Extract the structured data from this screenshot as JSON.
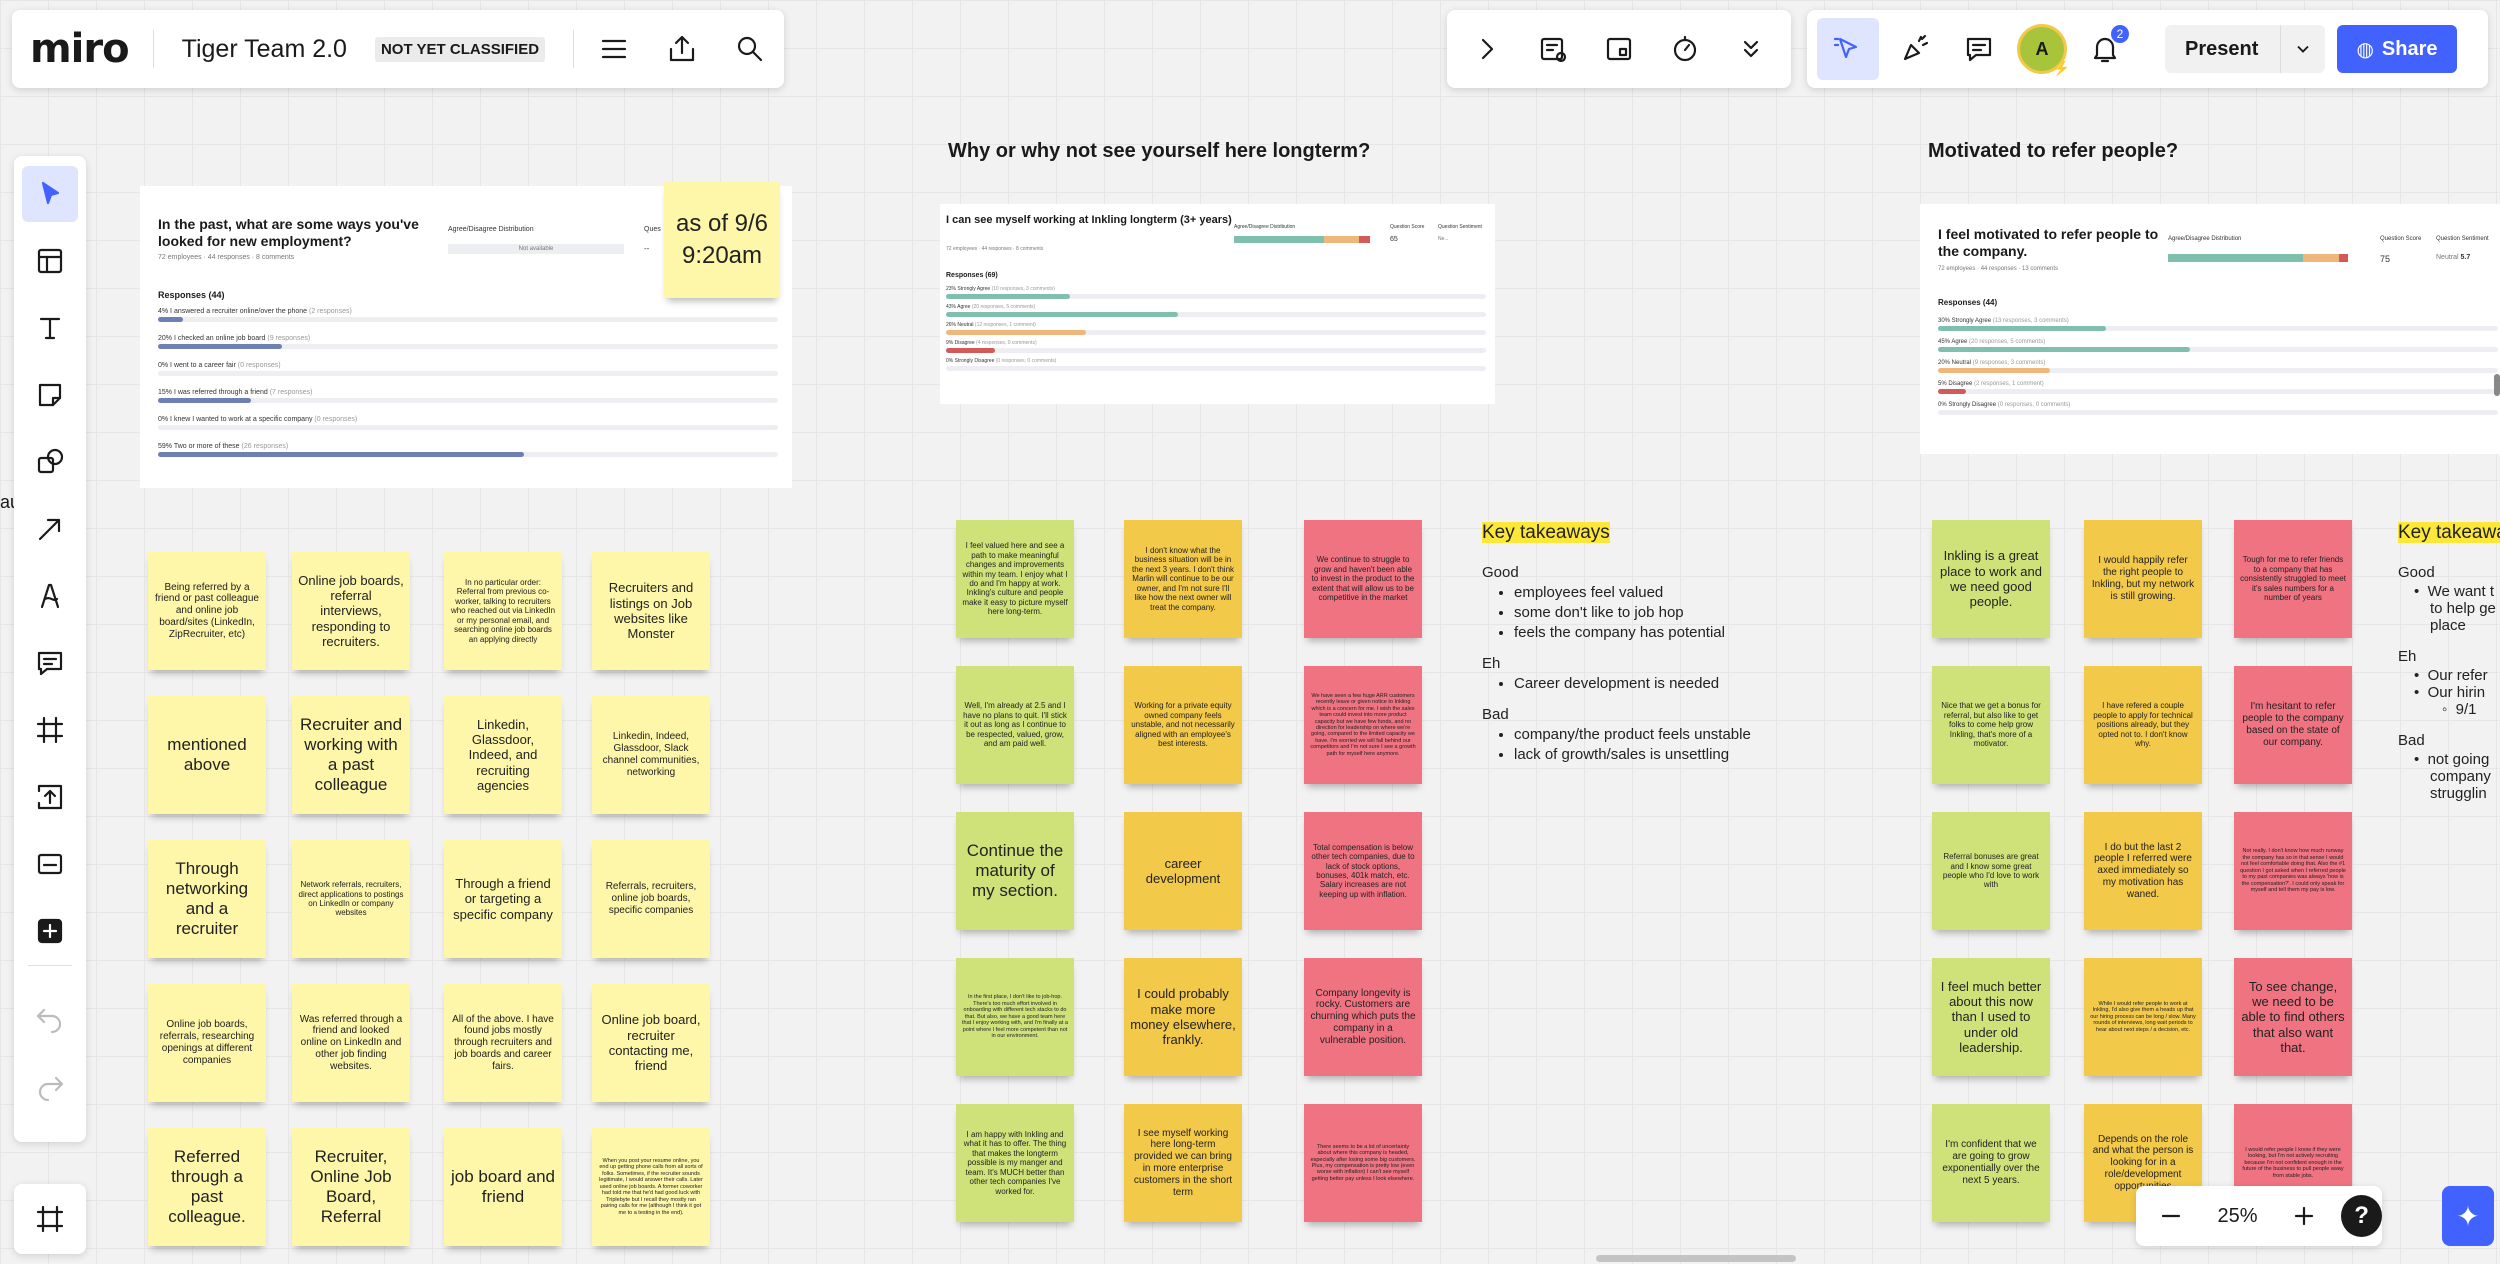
{
  "app": {
    "logo": "miro",
    "board_title": "Tiger Team 2.0",
    "classification": "NOT YET CLASSIFIED"
  },
  "header": {
    "present_label": "Present",
    "share_label": "Share",
    "notification_count": "2",
    "avatar_initial": "A"
  },
  "zoom": {
    "level": "25%",
    "help": "?"
  },
  "sections": {
    "s2_title": "Why or why not see yourself here longterm?",
    "s3_title": "Motivated to refer people?"
  },
  "card1": {
    "question": "In the past, what are some ways you've looked for new employment?",
    "meta": "72 employees · 44 responses · 8 comments",
    "dist_label": "Agree/Disagree Distribution",
    "not_available": "Not available",
    "qscore_label": "Ques",
    "dash": "--",
    "responses_label": "Responses (44)",
    "rows": [
      {
        "label": "4% I answered a recruiter online/over the phone",
        "sub": "(2 responses)",
        "pct": 4
      },
      {
        "label": "20% I checked an online job board",
        "sub": "(9 responses)",
        "pct": 20
      },
      {
        "label": "0% I went to a career fair",
        "sub": "(0 responses)",
        "pct": 0
      },
      {
        "label": "15% I was referred through a friend",
        "sub": "(7 responses)",
        "pct": 15
      },
      {
        "label": "0% I knew I wanted to work at a specific company",
        "sub": "(0 responses)",
        "pct": 0
      },
      {
        "label": "59% Two or more of these",
        "sub": "(26 responses)",
        "pct": 59
      }
    ],
    "timestamp_note": "as of 9/6 9:20am"
  },
  "card2": {
    "question": "I can see myself working at Inkling longterm (3+ years)",
    "meta": "72 employees · 44 responses · 8 comments",
    "dist_label": "Agree/Disagree Distribution",
    "qscore_label": "Question Score",
    "qscore": "65",
    "sentiment_label": "Question Sentiment",
    "sentiment": "Ne...",
    "responses_label": "Responses (69)",
    "rows": [
      {
        "label": "23% Strongly Agree",
        "sub": "(10 responses, 3 comments)",
        "pct": 23,
        "color": "#7fbfae"
      },
      {
        "label": "43% Agree",
        "sub": "(20 responses, 5 comments)",
        "pct": 43,
        "color": "#7fbfae"
      },
      {
        "label": "26% Neutral",
        "sub": "(12 responses, 1 comment)",
        "pct": 26,
        "color": "#f0b77a"
      },
      {
        "label": "9% Disagree",
        "sub": "(4 responses, 0 comments)",
        "pct": 9,
        "color": "#d45a5a"
      },
      {
        "label": "0% Strongly Disagree",
        "sub": "(0 responses, 0 comments)",
        "pct": 0,
        "color": "#b33"
      }
    ]
  },
  "card3": {
    "question": "I feel motivated to refer people to the company.",
    "meta": "72 employees · 44 responses · 13 comments",
    "dist_label": "Agree/Disagree Distribution",
    "qscore_label": "Question Score",
    "qscore": "75",
    "sentiment_label": "Question Sentiment",
    "sentiment": "Neutral",
    "sentiment_value": "5.7",
    "responses_label": "Responses (44)",
    "rows": [
      {
        "label": "30% Strongly Agree",
        "sub": "(13 responses, 3 comments)",
        "pct": 30,
        "color": "#7fbfae"
      },
      {
        "label": "45% Agree",
        "sub": "(20 responses, 5 comments)",
        "pct": 45,
        "color": "#7fbfae"
      },
      {
        "label": "20% Neutral",
        "sub": "(9 responses, 3 comments)",
        "pct": 20,
        "color": "#f0b77a"
      },
      {
        "label": "5% Disagree",
        "sub": "(2 responses, 1 comment)",
        "pct": 5,
        "color": "#d45a5a"
      },
      {
        "label": "0% Strongly Disagree",
        "sub": "(0 responses, 0 comments)",
        "pct": 0,
        "color": "#b33"
      }
    ]
  },
  "notes_s1": [
    {
      "text": "Being referred by a friend or past colleague and online job board/sites (LinkedIn, ZipRecruiter, etc)",
      "size": "t3"
    },
    {
      "text": "Online job boards, referral interviews, responding to recruiters.",
      "size": "t2"
    },
    {
      "text": "In no particular order: Referral from previous co-worker, talking to recruiters who reached out via LinkedIn or my personal email, and searching online job boards an applying directly",
      "size": "t4"
    },
    {
      "text": "Recruiters and listings on Job websites like Monster",
      "size": "t2"
    },
    {
      "text": "mentioned above",
      "size": "t1"
    },
    {
      "text": "Recruiter and working with a past colleague",
      "size": "t1"
    },
    {
      "text": "Linkedin, Glassdoor, Indeed, and recruiting agencies",
      "size": "t2"
    },
    {
      "text": "Linkedin, Indeed, Glassdoor, Slack channel communities, networking",
      "size": "t3"
    },
    {
      "text": "Through networking and a recruiter",
      "size": "t1"
    },
    {
      "text": "Network referrals, recruiters, direct applications to postings on LinkedIn or company websites",
      "size": "t4"
    },
    {
      "text": "Through a friend or targeting a specific company",
      "size": "t2"
    },
    {
      "text": "Referrals, recruiters, online job boards, specific companies",
      "size": "t3"
    },
    {
      "text": "Online job boards, referrals, researching openings at different companies",
      "size": "t3"
    },
    {
      "text": "Was referred through a friend and looked online on LinkedIn and other job finding websites.",
      "size": "t3"
    },
    {
      "text": "All of the above. I have found jobs mostly through recruiters and job boards and career fairs.",
      "size": "t3"
    },
    {
      "text": "Online job board, recruiter contacting me, friend",
      "size": "t2"
    },
    {
      "text": "Referred through a past colleague.",
      "size": "t1"
    },
    {
      "text": "Recruiter, Online Job Board, Referral",
      "size": "t1"
    },
    {
      "text": "job board and friend",
      "size": "t1"
    },
    {
      "text": "When you post your resume online, you end up getting phone calls from all sorts of folks. Sometimes, if the recruiter sounds legitimate, I would answer their calls. Later used online job boards. A former coworker had told me that he'd had good luck with Triplebyte but I recall they mostly ran pairing calls for me (although I think it got me to a testing in the end).",
      "size": "t5"
    }
  ],
  "notes_s2": [
    {
      "text": "I feel valued here and see a path to make meaningful changes and improvements within my team. I enjoy what I do and I'm happy at work. Inkling's culture and people make it easy to picture myself here long-term.",
      "size": "t4",
      "c": "g"
    },
    {
      "text": "I don't know what the business situation will be in the next 3 years. I don't think Marlin will continue to be our owner, and I'm not sure I'll like how the next owner will treat the company.",
      "size": "t4",
      "c": "o"
    },
    {
      "text": "We continue to struggle to grow and haven't been able to invest in the product to the extent that will allow us to be competitive in the market",
      "size": "t4",
      "c": "r"
    },
    {
      "text": "Well, I'm already at 2.5 and I have no plans to quit. I'll stick it out as long as I continue to be respected, valued, grow, and am paid well.",
      "size": "t4",
      "c": "g"
    },
    {
      "text": "Working for a private equity owned company feels unstable, and not necessarily aligned with an employee's best interests.",
      "size": "t4",
      "c": "o"
    },
    {
      "text": "We have seen a few huge ARR customers recently leave or given notice to Inkling which is a concern for me. I wish the sales team could invest into more product capacity but we have few funds, and no direction for leadership on where we're going, compared to the limited capacity we have. I'm worried we will fall behind our competitors and I'm not sure I see a growth path for myself here anymore.",
      "size": "t5",
      "c": "r"
    },
    {
      "text": "Continue the maturity of my section.",
      "size": "t1",
      "c": "g"
    },
    {
      "text": "career development",
      "size": "t2",
      "c": "o"
    },
    {
      "text": "Total compensation is below other tech companies, due to lack of stock options, bonuses, 401k match, etc. Salary increases are not keeping up with inflation.",
      "size": "t4",
      "c": "r"
    },
    {
      "text": "In the first place, I don't like to job-hop. There's too much effort involved in onboarding with different tech stacks to do that. But also, we have a good team here that I enjoy working with, and I'm finally at a point where I feel more competent than not in our environment.",
      "size": "t5",
      "c": "g"
    },
    {
      "text": "I could probably make more money elsewhere, frankly.",
      "size": "t2",
      "c": "o"
    },
    {
      "text": "Company longevity is rocky. Customers are churning which puts the company in a vulnerable position.",
      "size": "t3",
      "c": "r"
    },
    {
      "text": "I am happy with Inkling and what it has to offer. The thing that makes the longterm possible is my manger and team. It's MUCH better than other tech companies I've worked for.",
      "size": "t4",
      "c": "g"
    },
    {
      "text": "I see myself working here long-term provided we can bring in more enterprise customers in the short term",
      "size": "t3",
      "c": "o"
    },
    {
      "text": "There seems to be a lot of uncertainty about where this company is headed, especially after losing some big customers. Plus, my compensation is pretty low (even worse with inflation) I can't see myself getting better pay unless I look elsewhere.",
      "size": "t5",
      "c": "r"
    }
  ],
  "takeaways_s2": {
    "title": "Key takeaways",
    "good_label": "Good",
    "good": [
      "employees feel valued",
      "some don't like to job hop",
      "feels the company has potential"
    ],
    "eh_label": "Eh",
    "eh": [
      "Career development is needed"
    ],
    "bad_label": "Bad",
    "bad": [
      "company/the product feels unstable",
      "lack of growth/sales is unsettling"
    ]
  },
  "notes_s3": [
    {
      "text": "Inkling is a great place to work and we need good people.",
      "size": "t2",
      "c": "g"
    },
    {
      "text": "I would happily refer the right people to Inkling, but my network is still growing.",
      "size": "t3",
      "c": "o"
    },
    {
      "text": "Tough for me to refer friends to a company that has consistently struggled to meet it's sales numbers for a number of years",
      "size": "t4",
      "c": "r"
    },
    {
      "text": "Nice that we get a bonus for referral, but also like to get folks to come help grow Inkling, that's more of a motivator.",
      "size": "t4",
      "c": "g"
    },
    {
      "text": "I have refered a couple people to apply for technical positions already, but they opted not to. I don't know why.",
      "size": "t4",
      "c": "o"
    },
    {
      "text": "I'm hesitant to refer people to the company based on the state of our company.",
      "size": "t3",
      "c": "r"
    },
    {
      "text": "Referral bonuses are great and I know some great people who I'd love to work with",
      "size": "t4",
      "c": "g"
    },
    {
      "text": "I do but the last 2 people I referred were axed immediately so my motivation has waned.",
      "size": "t3",
      "c": "o"
    },
    {
      "text": "Not really. I don't know how much runway the company has so in that sense I would not feel comfortable doing that. Also the #1 question I got asked when I referred people to my past companies was always 'how is the compensation?'. I could only speak for myself and tell them my pay is low.",
      "size": "t5",
      "c": "r"
    },
    {
      "text": "I feel much better about this now than I used to under old leadership.",
      "size": "t2",
      "c": "g"
    },
    {
      "text": "While I would refer people to work at Inkling, I'd also give them a heads up that our hiring process can be long / slow. Many rounds of interviews, long wait periods to hear about next steps / a decision, etc.",
      "size": "t5",
      "c": "o"
    },
    {
      "text": "To see change, we need to be able to find others that also want that.",
      "size": "t2",
      "c": "r"
    },
    {
      "text": "I'm confident that we are going to grow exponentially over the next 5 years.",
      "size": "t3",
      "c": "g"
    },
    {
      "text": "Depends on the role and what the person is looking for in a role/development opportunities",
      "size": "t3",
      "c": "o"
    },
    {
      "text": "I would refer people I know if they were looking, but I'm not actively recruiting because I'm not confident enough in the future of the business to pull people away from stable jobs.",
      "size": "t5",
      "c": "r"
    }
  ],
  "takeaways_s3": {
    "title": "Key takeaways",
    "good_label": "Good",
    "good_line1": "We want t",
    "good_line2": "to help ge",
    "good_line3": "place",
    "eh_label": "Eh",
    "eh_line1": "Our refer",
    "eh_line2": "Our hirin",
    "eh_line3": "9/1",
    "bad_label": "Bad",
    "bad_line1": "not going",
    "bad_line2": "company",
    "bad_line3": "strugglin"
  },
  "side_text": "au",
  "icons": {
    "left_toolbar": [
      "select-cursor-icon",
      "templates-icon",
      "text-icon",
      "sticky-note-icon",
      "shapes-icon",
      "arrow-line-icon",
      "pen-icon",
      "comment-icon",
      "frame-icon",
      "upload-icon",
      "card-icon",
      "add-more-icon"
    ],
    "top_right": [
      "chevron-right-icon",
      "board-settings-icon",
      "presentation-icon",
      "timer-icon",
      "more-tools-icon"
    ],
    "collab": [
      "cursor-select-icon",
      "reaction-icon",
      "chat-icon",
      "avatar",
      "bell-icon"
    ]
  },
  "colors": {
    "accent": "#4262ff",
    "bar_blue": "#6e7fb3",
    "note_yellow": "#fef6a8",
    "note_green": "#cfe27a",
    "note_orange": "#f3c94a",
    "note_red": "#f07382",
    "highlight": "#fde83a"
  }
}
